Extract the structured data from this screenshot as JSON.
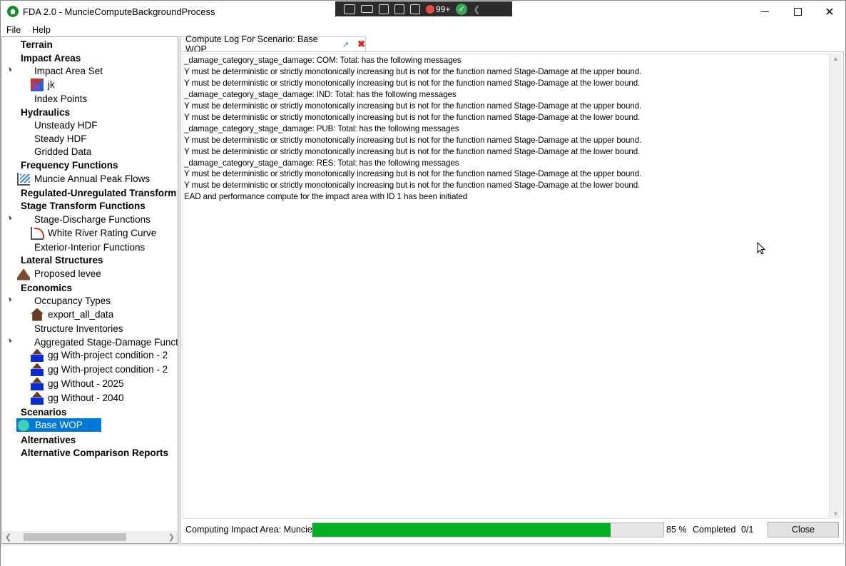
{
  "window": {
    "title": "FDA 2.0 - MuncieComputeBackgroundProcess"
  },
  "toolbar": {
    "notification_count": "99+"
  },
  "menu": {
    "items": [
      "File",
      "Help"
    ]
  },
  "tree": {
    "items": [
      {
        "label": "Terrain"
      },
      {
        "label": "Impact Areas"
      },
      {
        "label": "Impact Area Set"
      },
      {
        "label": "jk"
      },
      {
        "label": "Index Points"
      },
      {
        "label": "Hydraulics"
      },
      {
        "label": "Unsteady HDF"
      },
      {
        "label": "Steady HDF"
      },
      {
        "label": "Gridded Data"
      },
      {
        "label": "Frequency Functions"
      },
      {
        "label": "Muncie Annual Peak Flows"
      },
      {
        "label": "Regulated-Unregulated Transform"
      },
      {
        "label": "Stage Transform Functions"
      },
      {
        "label": "Stage-Discharge Functions"
      },
      {
        "label": "White River Rating Curve"
      },
      {
        "label": "Exterior-Interior Functions"
      },
      {
        "label": "Lateral Structures"
      },
      {
        "label": "Proposed levee"
      },
      {
        "label": "Economics"
      },
      {
        "label": "Occupancy Types"
      },
      {
        "label": "export_all_data"
      },
      {
        "label": "Structure Inventories"
      },
      {
        "label": "Aggregated Stage-Damage Functions"
      },
      {
        "label": "gg With-project condition - 2"
      },
      {
        "label": "gg With-project condition - 2"
      },
      {
        "label": "gg Without - 2025"
      },
      {
        "label": "gg Without - 2040"
      },
      {
        "label": "Scenarios"
      },
      {
        "label": "Base WOP"
      },
      {
        "label": "Alternatives"
      },
      {
        "label": "Alternative Comparison Reports"
      }
    ]
  },
  "tab": {
    "label": "Compute Log For Scenario: Base WOP"
  },
  "log": {
    "lines": [
      "_damage_category_stage_damage: COM: Total: has the following messages",
      "Y must be deterministic or strictly monotonically increasing but is not for the function named Stage-Damage at the upper bound.",
      "Y must be deterministic or strictly monotonically increasing but is not for the function named Stage-Damage at the lower bound.",
      "_damage_category_stage_damage: IND: Total: has the following messages",
      "Y must be deterministic or strictly monotonically increasing but is not for the function named Stage-Damage at the upper bound.",
      "Y must be deterministic or strictly monotonically increasing but is not for the function named Stage-Damage at the lower bound.",
      "_damage_category_stage_damage: PUB: Total: has the following messages",
      "Y must be deterministic or strictly monotonically increasing but is not for the function named Stage-Damage at the upper bound.",
      "Y must be deterministic or strictly monotonically increasing but is not for the function named Stage-Damage at the lower bound.",
      "_damage_category_stage_damage: RES: Total: has the following messages",
      "Y must be deterministic or strictly monotonically increasing but is not for the function named Stage-Damage at the upper bound.",
      "Y must be deterministic or strictly monotonically increasing but is not for the function named Stage-Damage at the lower bound.",
      "EAD and performance compute for the impact area with ID 1 has been initiated"
    ]
  },
  "status": {
    "computing_label": "Computing Impact Area: Muncie",
    "progress_fraction": 0.85,
    "percent_text": "85 %",
    "completed_label": "Completed",
    "count_text": "0/1",
    "close_label": "Close",
    "progress_color": "#06b025"
  },
  "selection_color": "#0078d7"
}
